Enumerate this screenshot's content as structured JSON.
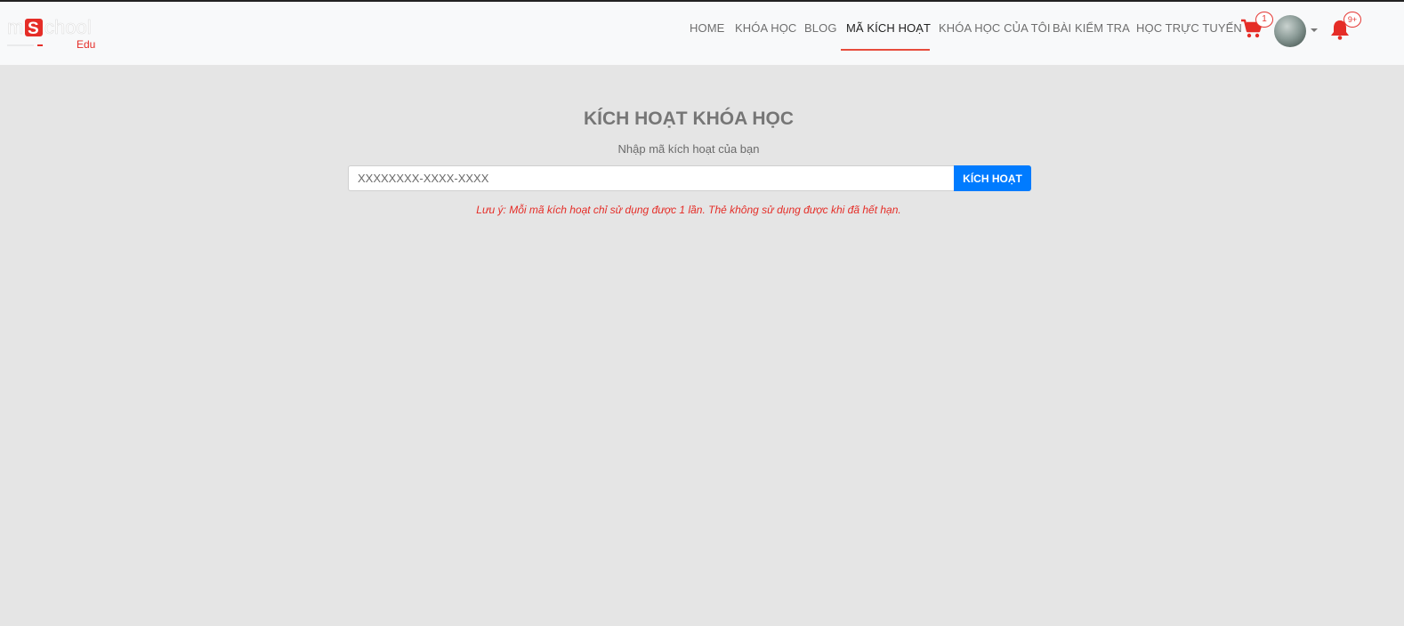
{
  "brand": {
    "logo_main": "mSchool",
    "logo_sub": "Edu",
    "accent_color": "#e52d27",
    "primary_color": "#007bff"
  },
  "nav": {
    "items": [
      {
        "label": "HOME"
      },
      {
        "label": "KHÓA HỌC"
      },
      {
        "label": "BLOG"
      },
      {
        "label": "MÃ KÍCH HOẠT",
        "active": true
      },
      {
        "label": "KHÓA HỌC CỦA TÔI"
      },
      {
        "label": "BÀI KIỂM TRA"
      },
      {
        "label": "HỌC TRỰC TUYẾN"
      }
    ],
    "cart_count": "1",
    "notification_count": "9+",
    "icons": [
      "cart-icon",
      "avatar",
      "chevron-down-icon",
      "bell-icon"
    ]
  },
  "main": {
    "title": "KÍCH HOẠT KHÓA HỌC",
    "subtitle": "Nhập mã kích hoạt của bạn",
    "input_placeholder": "XXXXXXXX-XXXX-XXXX",
    "input_value": "",
    "button_label": "KÍCH HOẠT",
    "note": "Lưu ý: Mỗi mã kích hoạt chỉ sử dụng được 1 lần. Thẻ không sử dụng được khi đã hết hạn."
  }
}
